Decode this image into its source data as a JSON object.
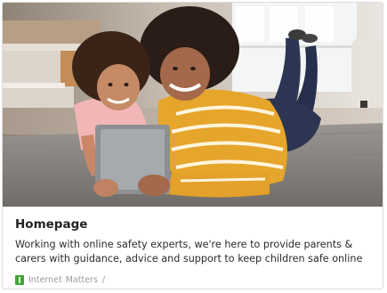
{
  "card": {
    "title": "Homepage",
    "description": "Working with online safety experts, we're here to provide parents & carers with guidance, advice and support to keep children safe online",
    "image_alt": "Mother and daughter lying on a rug looking at a tablet",
    "source": {
      "logo_icon": "internet-matters-logo-icon",
      "word1": "Internet",
      "word2": "Matters",
      "separator": "/",
      "logo_color": "#3fa535"
    }
  }
}
